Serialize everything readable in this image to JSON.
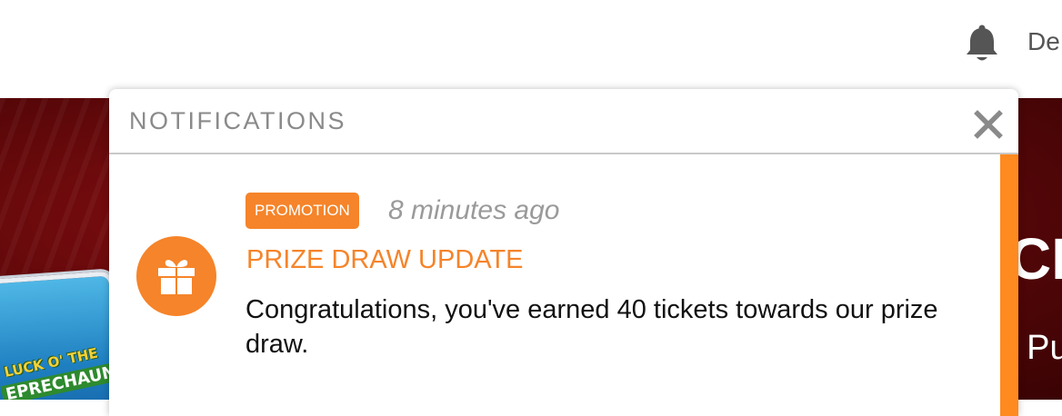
{
  "header": {
    "user_name": "De",
    "bell_icon": "bell-icon"
  },
  "hero": {
    "game_title_line1": "LUCK O' THE",
    "game_title_line2": "EPRECHAUN",
    "headline": "CH",
    "subline": "t Pu"
  },
  "notifications": {
    "title": "NOTIFICATIONS",
    "close_icon": "close-icon",
    "items": [
      {
        "badge": "PROMOTION",
        "time": "8 minutes ago",
        "title": "PRIZE DRAW UPDATE",
        "message": "Congratulations, you've earned 40 tickets towards our prize draw.",
        "icon": "gift-icon"
      }
    ]
  },
  "colors": {
    "accent": "#f5842a",
    "accent_bar": "#ff8a1f",
    "hero_bg": "#5a0709",
    "muted_text": "#8a8a8a"
  }
}
